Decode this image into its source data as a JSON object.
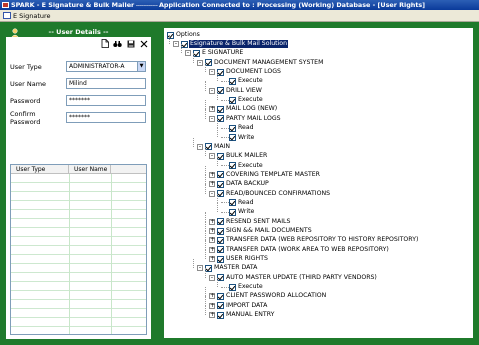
{
  "window": {
    "title_app": "SPARK - E Signature & Bulk Mailer",
    "title_sep": " ------------ ",
    "title_status": "Application Connected to : Processing (Working) Database - [User Rights]"
  },
  "menu": {
    "item": "E Signature"
  },
  "left_panel": {
    "header": "-- User Details --",
    "toolbar_icons": [
      "new-document-icon",
      "find-icon",
      "save-icon",
      "close-icon"
    ],
    "form": {
      "user_type_label": "User Type",
      "user_type_value": "ADMINISTRATOR-A",
      "user_name_label": "User Name",
      "user_name_value": "Milind",
      "password_label": "Password",
      "password_value": "*******",
      "confirm_password_label": "Confirm Password",
      "confirm_password_value": "*******"
    },
    "grid": {
      "columns": [
        "User Type",
        "User Name"
      ]
    }
  },
  "tree": {
    "root_label": "Options",
    "nodes": [
      {
        "label": "Esignature & Bulk Mail Solution",
        "level": 1,
        "expander": "-",
        "selected": true
      },
      {
        "label": "E SIGNATURE",
        "level": 2,
        "expander": "-"
      },
      {
        "label": "DOCUMENT MANAGEMENT SYSTEM",
        "level": 3,
        "expander": "-"
      },
      {
        "label": "DOCUMENT LOGS",
        "level": 4,
        "expander": "-"
      },
      {
        "label": "Execute",
        "level": 5,
        "expander": ""
      },
      {
        "label": "DRILL VIEW",
        "level": 4,
        "expander": "-"
      },
      {
        "label": "Execute",
        "level": 5,
        "expander": ""
      },
      {
        "label": "MAIL LOG (NEW)",
        "level": 4,
        "expander": "+"
      },
      {
        "label": "PARTY MAIL LOGS",
        "level": 4,
        "expander": "-"
      },
      {
        "label": "Read",
        "level": 5,
        "expander": ""
      },
      {
        "label": "Write",
        "level": 5,
        "expander": ""
      },
      {
        "label": "MAIN",
        "level": 3,
        "expander": "-"
      },
      {
        "label": "BULK MAILER",
        "level": 4,
        "expander": "-"
      },
      {
        "label": "Execute",
        "level": 5,
        "expander": ""
      },
      {
        "label": "COVERING TEMPLATE MASTER",
        "level": 4,
        "expander": "+"
      },
      {
        "label": "DATA BACKUP",
        "level": 4,
        "expander": "+"
      },
      {
        "label": "READ/BOUNCED CONFIRMATIONS",
        "level": 4,
        "expander": "-"
      },
      {
        "label": "Read",
        "level": 5,
        "expander": ""
      },
      {
        "label": "Write",
        "level": 5,
        "expander": ""
      },
      {
        "label": "RESEND SENT MAILS",
        "level": 4,
        "expander": "+"
      },
      {
        "label": "SIGN && MAIL DOCUMENTS",
        "level": 4,
        "expander": "+"
      },
      {
        "label": "TRANSFER DATA (WEB REPOSITORY TO HISTORY REPOSITORY)",
        "level": 4,
        "expander": "+"
      },
      {
        "label": "TRANSFER DATA (WORK AREA TO WEB REPOSITORY)",
        "level": 4,
        "expander": "+"
      },
      {
        "label": "USER RIGHTS",
        "level": 4,
        "expander": "+"
      },
      {
        "label": "MASTER DATA",
        "level": 3,
        "expander": "-"
      },
      {
        "label": "AUTO MASTER UPDATE (THIRD PARTY VENDORS)",
        "level": 4,
        "expander": "-"
      },
      {
        "label": "Execute",
        "level": 5,
        "expander": ""
      },
      {
        "label": "CLIENT PASSWORD ALLOCATION",
        "level": 4,
        "expander": "+"
      },
      {
        "label": "IMPORT DATA",
        "level": 4,
        "expander": "+"
      },
      {
        "label": "MANUAL ENTRY",
        "level": 4,
        "expander": "+"
      }
    ]
  },
  "colors": {
    "frame_green": "#1f7a2b",
    "title_blue": "#0a3a9a",
    "selected_blue": "#0a246a"
  }
}
